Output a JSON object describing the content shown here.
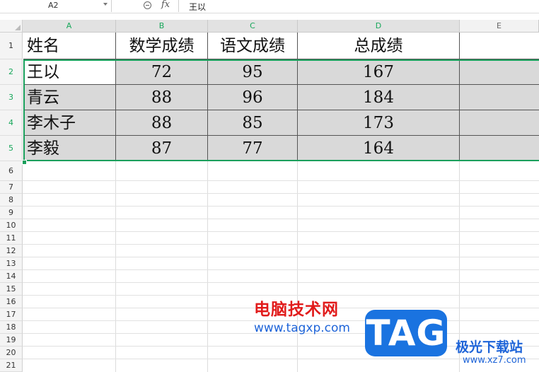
{
  "formula_bar": {
    "name_box": "A2",
    "fx_label": "fx",
    "formula_value": "王以"
  },
  "columns": [
    "A",
    "B",
    "C",
    "D",
    "E"
  ],
  "rows": [
    "1",
    "2",
    "3",
    "4",
    "5",
    "6",
    "7",
    "8",
    "9",
    "10",
    "11",
    "12",
    "13",
    "14",
    "15",
    "16",
    "17",
    "18",
    "19",
    "20",
    "21"
  ],
  "table": {
    "headers": [
      "姓名",
      "数学成绩",
      "语文成绩",
      "总成绩"
    ],
    "data": [
      [
        "王以",
        "72",
        "95",
        "167"
      ],
      [
        "青云",
        "88",
        "96",
        "184"
      ],
      [
        "李木子",
        "88",
        "85",
        "173"
      ],
      [
        "李毅",
        "87",
        "77",
        "164"
      ]
    ]
  },
  "selection": {
    "active_cell": "A2",
    "range": "A2:E5",
    "color": "#1a9f5c"
  },
  "colors": {
    "cell_fill": "#d9d9d9",
    "header_selected_text": "#17a75a"
  },
  "watermark": {
    "title": "电脑技术网",
    "url": "www.tagxp.com",
    "badge": "TAG",
    "brand": "极光下载站",
    "brand_url": "www.xz7.com"
  }
}
